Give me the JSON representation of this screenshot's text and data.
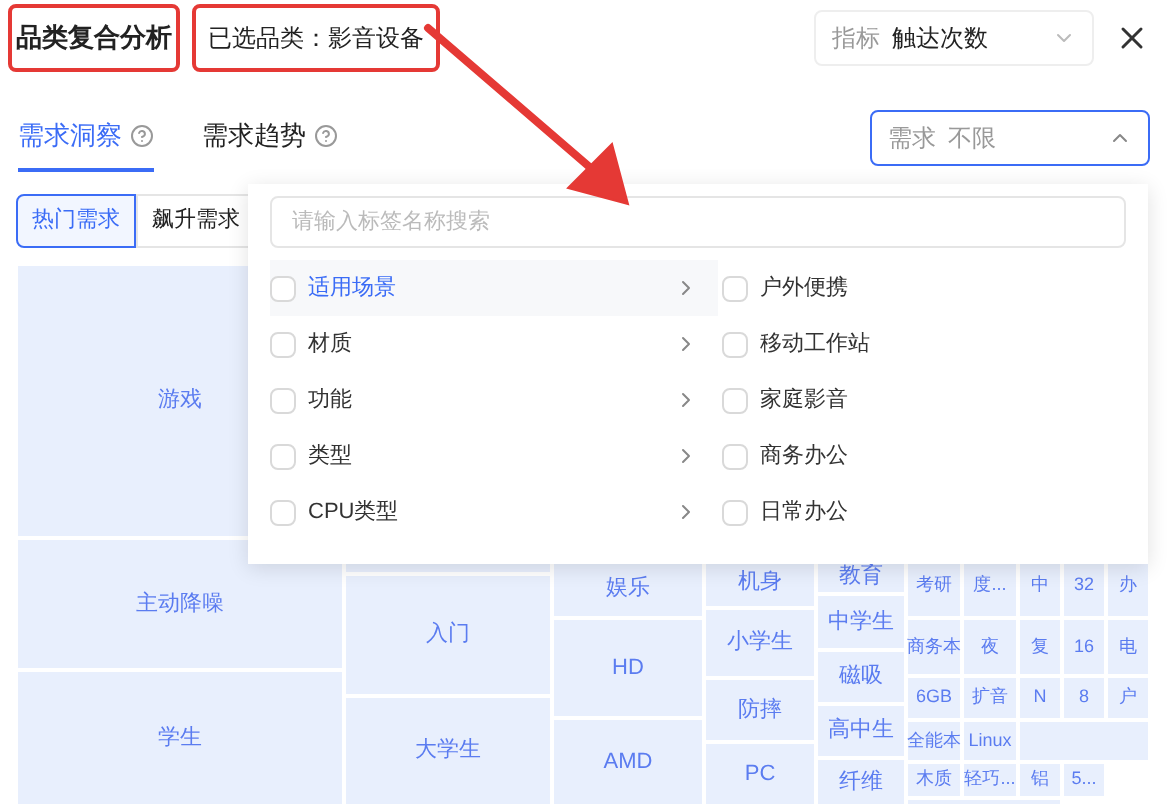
{
  "header": {
    "title": {
      "text": "品类复合分析",
      "highlighted": true
    },
    "selected_category": {
      "text": "已选品类：影音设备",
      "highlighted": true
    },
    "metric_select": {
      "label": "指标",
      "value": "触达次数"
    }
  },
  "tabs": [
    {
      "label": "需求洞察",
      "selected": true
    },
    {
      "label": "需求趋势",
      "selected": false
    }
  ],
  "demand_select": {
    "label": "需求",
    "value": "不限",
    "expanded": true
  },
  "segments": [
    {
      "label": "热门需求",
      "selected": true
    },
    {
      "label": "飙升需求",
      "selected": false
    }
  ],
  "dropdown": {
    "placeholder": "请输入标签名称搜索",
    "categories": [
      {
        "label": "适用场景",
        "selected": true,
        "checked": false
      },
      {
        "label": "材质",
        "selected": false,
        "checked": false
      },
      {
        "label": "功能",
        "selected": false,
        "checked": false
      },
      {
        "label": "类型",
        "selected": false,
        "checked": false
      },
      {
        "label": "CPU类型",
        "selected": false,
        "checked": false
      }
    ],
    "options": [
      {
        "label": "户外便携",
        "checked": false
      },
      {
        "label": "移动工作站",
        "checked": false
      },
      {
        "label": "家庭影音",
        "checked": false
      },
      {
        "label": "商务办公",
        "checked": false
      },
      {
        "label": "日常办公",
        "checked": false
      }
    ]
  },
  "treemap": {
    "columns": [
      {
        "kind": "cells",
        "cells": [
          "游戏",
          "主动降噪",
          "学生"
        ]
      },
      {
        "kind": "cells",
        "cells": [
          "入门",
          "大学生"
        ]
      },
      {
        "kind": "cells",
        "cells": [
          "娱乐",
          "HD",
          "AMD"
        ]
      },
      {
        "kind": "cells",
        "cells": [
          "机身",
          "小学生",
          "防摔",
          "PC"
        ]
      },
      {
        "kind": "cells",
        "cells": [
          "教育",
          "中学生",
          "磁吸",
          "高中生",
          "纤维"
        ]
      },
      {
        "kind": "rows",
        "rows": [
          [
            "考研",
            "度...",
            "中",
            "32",
            "办"
          ],
          [
            "商务本",
            "夜",
            "复",
            "16",
            "电"
          ],
          [
            "6GB",
            "扩音",
            "N",
            "8",
            "户"
          ],
          [
            "全能本",
            "Linux"
          ],
          [
            "木质",
            "轻巧...",
            "铝",
            "5..."
          ]
        ]
      }
    ]
  }
}
